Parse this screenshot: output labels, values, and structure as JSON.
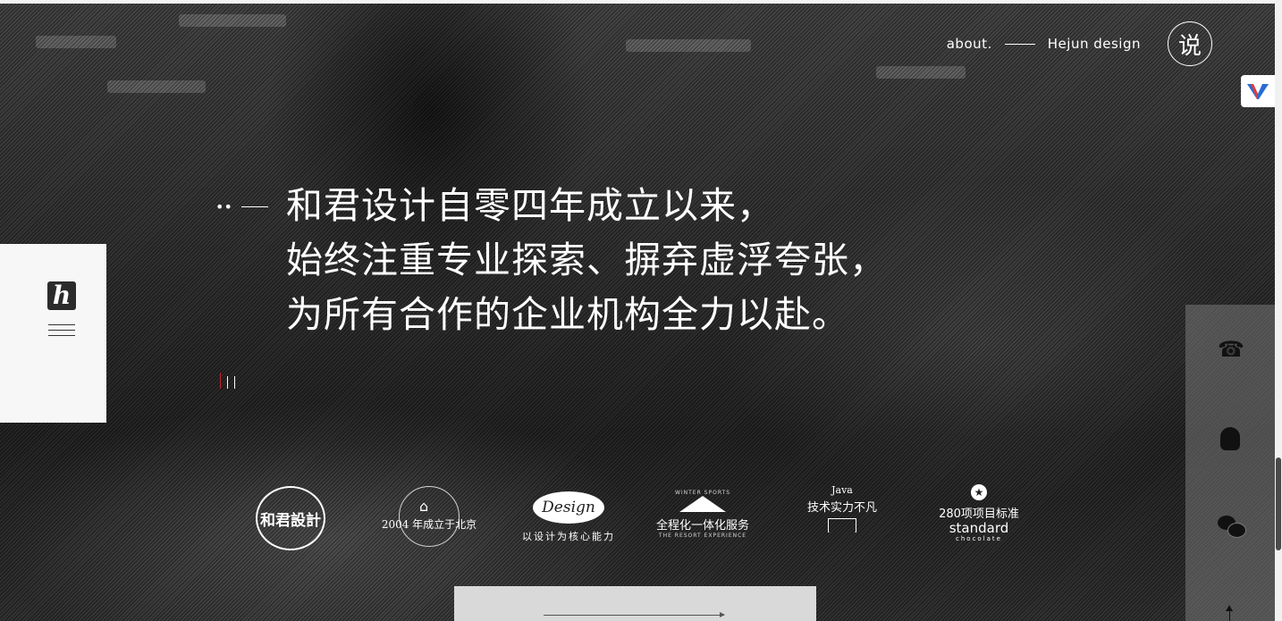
{
  "nav": {
    "about_label": "about.",
    "brand_label": "Hejun design",
    "shuo_label": "说"
  },
  "sidebar": {
    "logo_letter": "h"
  },
  "headline": {
    "quote_mark": "••",
    "lines": [
      "和君设计自零四年成立以来，",
      "始终注重专业探索、摒弃虚浮夸张，",
      "为所有合作的企业机构全力以赴。"
    ],
    "slide_count": 3,
    "active_slide": 1
  },
  "badges": {
    "seal_text": "和君設計",
    "founded_text": "2004 年成立于北京",
    "design_word": "Design",
    "design_sub": "以设计为核心能力",
    "service_top": "WINTER SPORTS",
    "service_text": "全程化一体化服务",
    "service_bottom": "THE RESORT EXPERIENCE",
    "java_word": "Java",
    "tech_text": "技术实力不凡",
    "standard_count": "280项项目标准",
    "standard_word": "standard",
    "standard_sub": "chocolate"
  },
  "contact": {
    "phone_icon": "phone-icon",
    "qq_icon": "qq-icon",
    "wechat_icon": "wechat-icon"
  },
  "colors": {
    "accent_red": "#c0242a",
    "panel_bg": "#f7f7f7",
    "contact_bg": "#7a7a7a"
  }
}
